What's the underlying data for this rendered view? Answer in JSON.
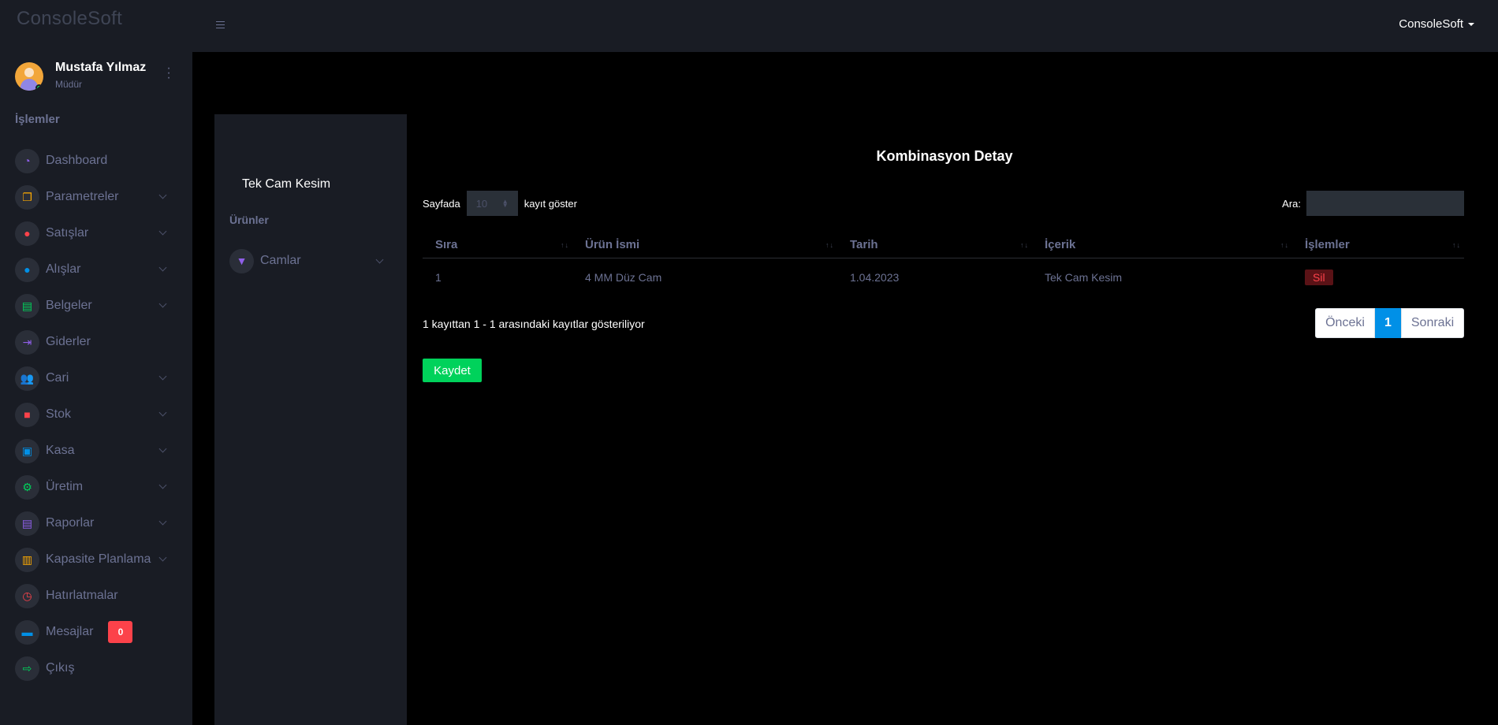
{
  "brand": "ConsoleSoft",
  "topbar": {
    "user_menu": "ConsoleSoft"
  },
  "profile": {
    "name": "Mustafa Yılmaz",
    "role": "Müdür"
  },
  "sidebar": {
    "section": "İşlemler",
    "items": [
      {
        "label": "Dashboard",
        "icon": "speedometer-icon",
        "color": "#8f5fe8"
      },
      {
        "label": "Parametreler",
        "icon": "layers-icon",
        "color": "#ffab00"
      },
      {
        "label": "Satışlar",
        "icon": "play-circle-icon",
        "color": "#fc424a"
      },
      {
        "label": "Alışlar",
        "icon": "message-circle-icon",
        "color": "#0090e7"
      },
      {
        "label": "Belgeler",
        "icon": "book-icon",
        "color": "#00d25b"
      },
      {
        "label": "Giderler",
        "icon": "arrow-to-right-icon",
        "color": "#8f5fe8"
      },
      {
        "label": "Cari",
        "icon": "people-icon",
        "color": "#ffab00"
      },
      {
        "label": "Stok",
        "icon": "stack-icon",
        "color": "#fc424a"
      },
      {
        "label": "Kasa",
        "icon": "cash-box-icon",
        "color": "#0090e7"
      },
      {
        "label": "Üretim",
        "icon": "factory-icon",
        "color": "#00d25b"
      },
      {
        "label": "Raporlar",
        "icon": "report-icon",
        "color": "#8f5fe8"
      },
      {
        "label": "Kapasite Planlama",
        "icon": "clipboard-icon",
        "color": "#ffab00"
      },
      {
        "label": "Hatırlatmalar",
        "icon": "timer-icon",
        "color": "#fc424a"
      },
      {
        "label": "Mesajlar",
        "icon": "chat-icon",
        "color": "#0090e7",
        "badge": "0"
      },
      {
        "label": "Çıkış",
        "icon": "logout-icon",
        "color": "#00d25b"
      }
    ]
  },
  "panel": {
    "title": "Tek Cam Kesim",
    "subtitle": "Ürünler",
    "item": {
      "label": "Camlar",
      "icon": "glass-icon",
      "color": "#8f5fe8"
    }
  },
  "main": {
    "title": "Kombinasyon Detay",
    "length_prefix": "Sayfada",
    "length_value": "10",
    "length_suffix": "kayıt göster",
    "search_label": "Ara:",
    "search_value": "",
    "columns": [
      "Sıra",
      "Ürün İsmi",
      "Tarih",
      "İçerik",
      "İşlemler"
    ],
    "rows": [
      {
        "sira": "1",
        "urun": "4 MM Düz Cam",
        "tarih": "1.04.2023",
        "icerik": "Tek Cam Kesim",
        "action": "Sil"
      }
    ],
    "info": "1 kayıttan 1 - 1 arasındaki kayıtlar gösteriliyor",
    "pagination": {
      "prev": "Önceki",
      "current": "1",
      "next": "Sonraki"
    },
    "save_label": "Kaydet"
  }
}
